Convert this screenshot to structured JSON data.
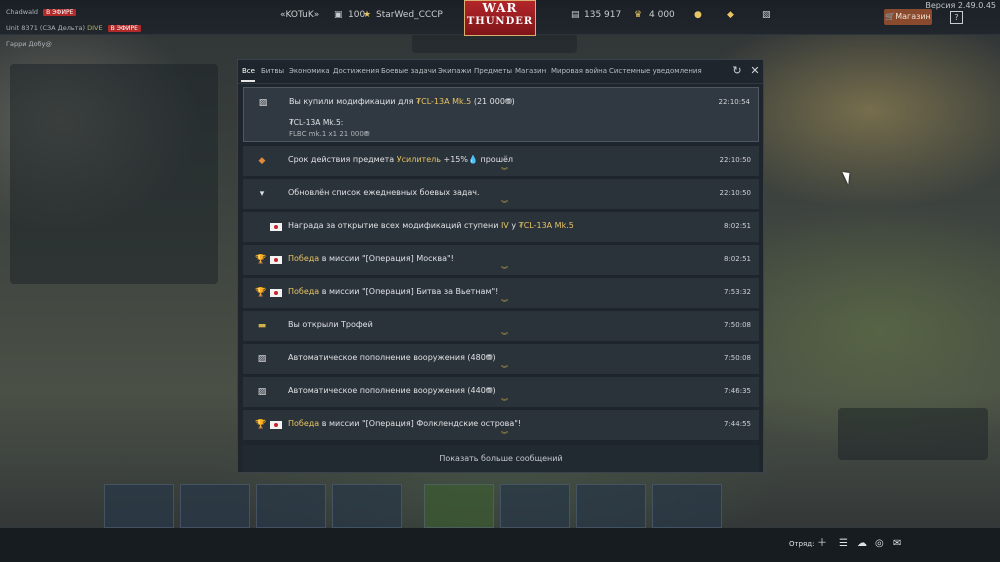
{
  "topbar": {
    "version": "Версия 2.49.0.45",
    "clan_tag": "«KOTuK»",
    "level": "100",
    "nickname": "StarWed_CCCP",
    "logo_line1": "WAR",
    "logo_line2": "THUNDER",
    "silver_lions": "135 917",
    "golden_eagles": "4 000",
    "shop_label": "Магазин",
    "help_label": "?"
  },
  "squad_list": [
    {
      "name": "Chadwald",
      "badge": "В ЭФИРЕ"
    },
    {
      "name": "Unit 8371 (СЗА Дельта)",
      "extra": "DIVE",
      "badge": "В ЭФИРЕ"
    },
    {
      "name": "Гарри Добу@"
    }
  ],
  "tabs": [
    "Все",
    "Битвы",
    "Экономика",
    "Достижения",
    "Боевые задачи",
    "Экипажи",
    "Предметы",
    "Магазин",
    "Мировая война",
    "Системные уведомления"
  ],
  "messages": [
    {
      "icon": "wrench-icon",
      "pre": "Вы купили модификации для ",
      "hl": "₮CL-13A Mk.5",
      "post": " (21 000⛃)",
      "time": "22:10:54",
      "sub1": "₮CL-13A Mk.5:",
      "sub2": "FLBC mk.1 x1 21 000⛃"
    },
    {
      "icon": "booster-icon",
      "pre": "Срок действия предмета ",
      "hl": "Усилитель",
      "post": " +15%💧 прошёл",
      "time": "22:10:50"
    },
    {
      "icon": "tasks-icon",
      "pre": "Обновлён список ежедневных боевых задач.",
      "hl": "",
      "post": "",
      "time": "22:10:50"
    },
    {
      "icon": "flag-icon",
      "pre": "Награда за открытие всех модификаций ступени ",
      "hl": "IV",
      "mid": " у ",
      "hl2": "₮CL-13A Mk.5",
      "post": "",
      "time": "8:02:51"
    },
    {
      "icon": "trophy-flag-icon",
      "pre": "",
      "hl": "Победа",
      "post": " в миссии \"[Операция] Москва\"!",
      "time": "8:02:51"
    },
    {
      "icon": "trophy-flag-icon",
      "pre": "",
      "hl": "Победа",
      "post": " в миссии \"[Операция] Битва за Вьетнам\"!",
      "time": "7:53:32"
    },
    {
      "icon": "chest-icon",
      "pre": "Вы открыли Трофей",
      "hl": "",
      "post": "",
      "time": "7:50:08"
    },
    {
      "icon": "wrench-icon",
      "pre": "Автоматическое пополнение вооружения (480⛃)",
      "hl": "",
      "post": "",
      "time": "7:50:08"
    },
    {
      "icon": "wrench-icon",
      "pre": "Автоматическое пополнение вооружения (440⛃)",
      "hl": "",
      "post": "",
      "time": "7:46:35"
    },
    {
      "icon": "trophy-flag-icon",
      "pre": "",
      "hl": "Победа",
      "post": " в миссии \"[Операция] Фолклендские острова\"!",
      "time": "7:44:55"
    }
  ],
  "show_more": "Показать больше сообщений",
  "bottombar": {
    "squad_label": "Отряд:"
  },
  "colors": {
    "highlight": "#e7c464",
    "dialog_bg": "#1e252c",
    "row_bg": "#2a323a",
    "shop_btn": "#8a4a2e",
    "logo_red": "#b3262a"
  }
}
